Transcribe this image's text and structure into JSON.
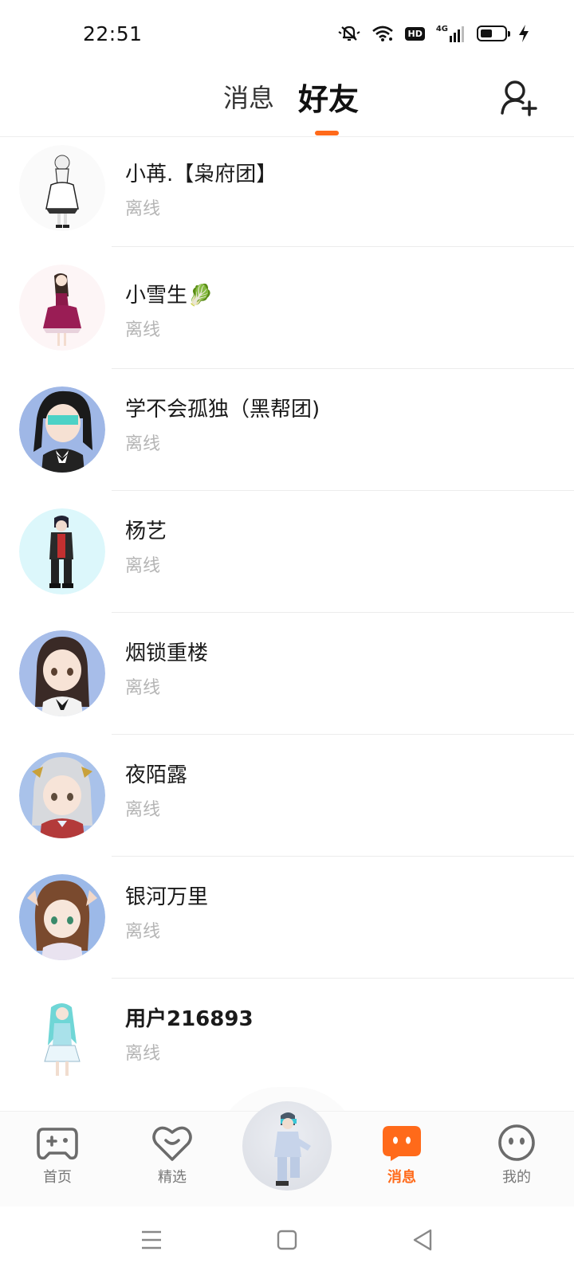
{
  "status_bar": {
    "time": "22:51",
    "icons": [
      "mute-bell-icon",
      "wifi-icon",
      "hd-icon",
      "signal-4g-icon",
      "battery-icon",
      "charging-icon"
    ],
    "hd_label": "HD",
    "network_label": "4G"
  },
  "header": {
    "tabs": [
      {
        "label": "消息",
        "active": false
      },
      {
        "label": "好友",
        "active": true
      }
    ],
    "accent_color": "#ff6a1a",
    "add_friend_icon": "add-user-icon"
  },
  "friends": [
    {
      "name": "小苒.【枭府团】",
      "status": "离线"
    },
    {
      "name": "小雪生🥬",
      "status": "离线"
    },
    {
      "name": "学不会孤独（黑帮团)",
      "status": "离线"
    },
    {
      "name": "杨艺",
      "status": "离线"
    },
    {
      "name": "烟锁重楼",
      "status": "离线"
    },
    {
      "name": "夜陌露",
      "status": "离线"
    },
    {
      "name": "银河万里",
      "status": "离线"
    },
    {
      "name": "用户216893",
      "status": "离线"
    }
  ],
  "bottom_nav": {
    "items": [
      {
        "label": "首页",
        "icon": "gamepad-icon",
        "active": false
      },
      {
        "label": "精选",
        "icon": "heart-chat-icon",
        "active": false
      },
      {
        "label": "消息",
        "icon": "chat-bubble-icon",
        "active": true
      },
      {
        "label": "我的",
        "icon": "face-icon",
        "active": false
      }
    ]
  },
  "system_nav": {
    "icons": [
      "menu-icon",
      "home-square-icon",
      "back-triangle-icon"
    ]
  }
}
